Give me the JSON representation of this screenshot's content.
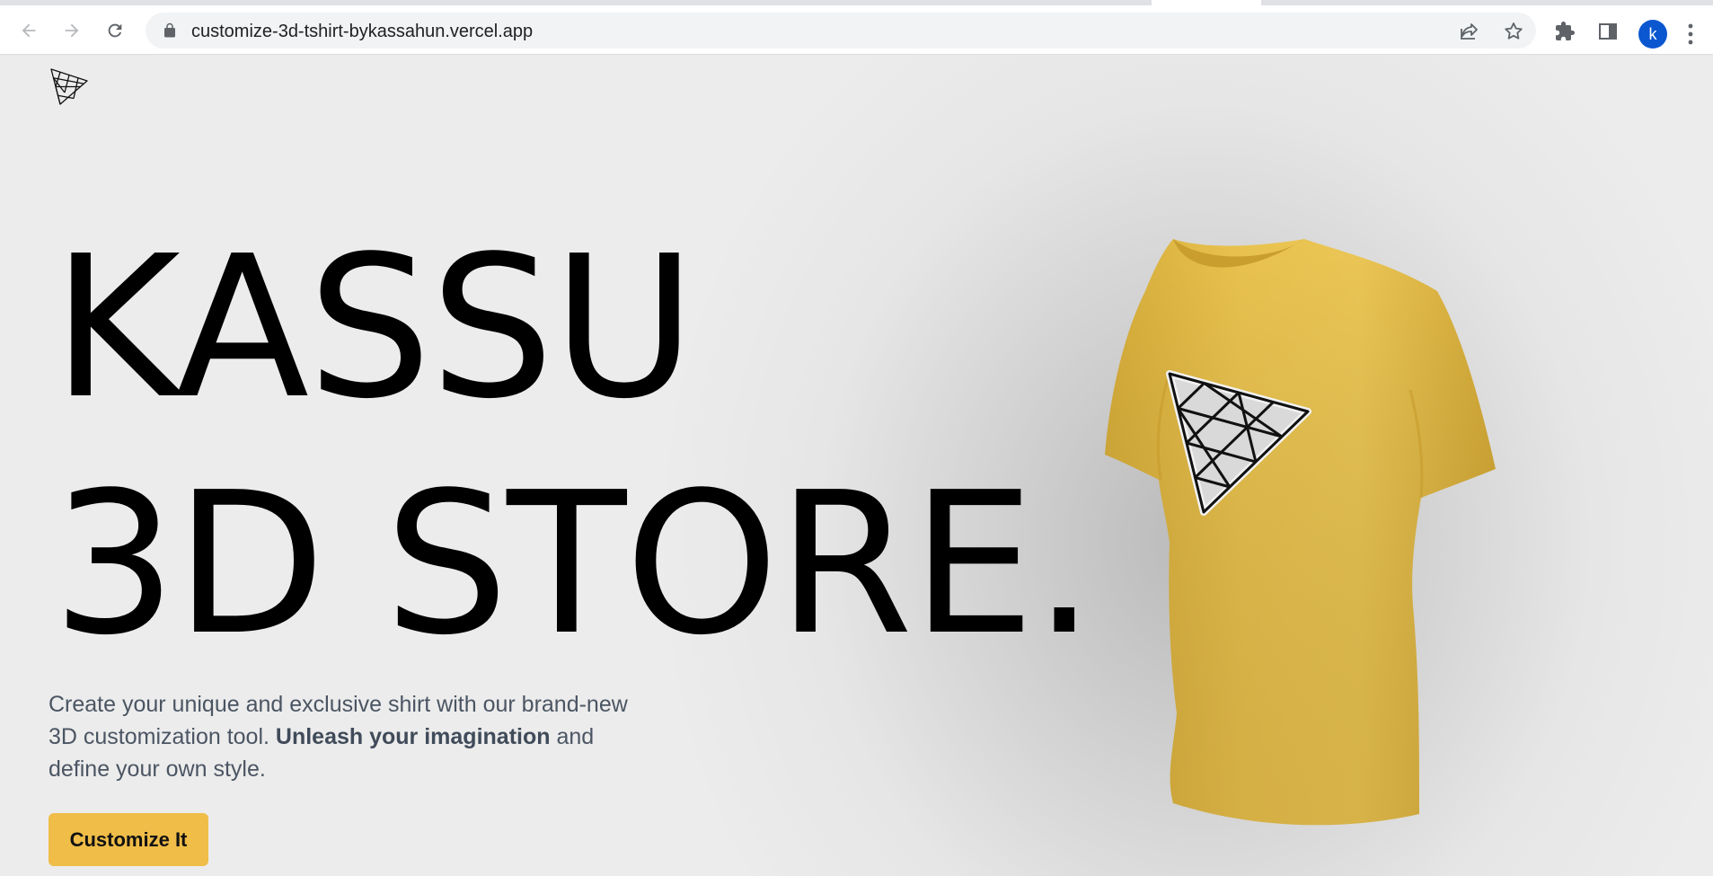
{
  "browser": {
    "url": "customize-3d-tshirt-bykassahun.vercel.app",
    "profile_initial": "k",
    "profile_color": "#0b57d0"
  },
  "hero": {
    "line1": "KASSU",
    "line2": "3D STORE."
  },
  "intro": {
    "text_before": "Create your unique and exclusive shirt with our brand-new 3D customization tool. ",
    "text_bold": "Unleash your imagination",
    "text_after": " and define your own style."
  },
  "cta": {
    "label": "Customize It",
    "color": "#efbd48"
  },
  "shirt": {
    "color": "#e9c24f",
    "decal": "threejs-triangle-logo"
  }
}
